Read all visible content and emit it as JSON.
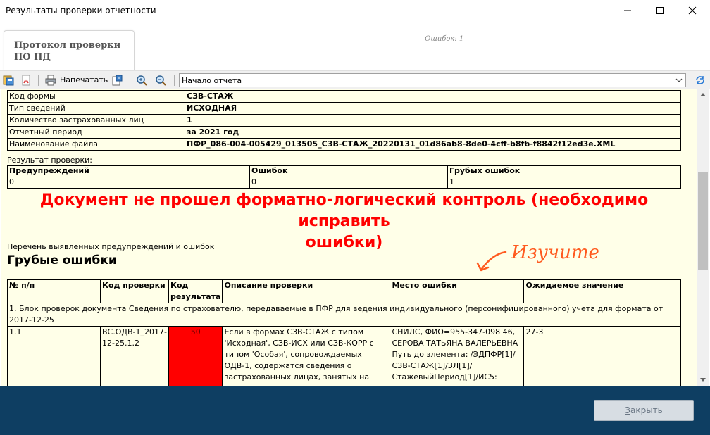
{
  "window": {
    "title": "Результаты проверки отчетности",
    "controls": {
      "minimize": "—",
      "maximize": "☐",
      "close": "✕"
    }
  },
  "tab": {
    "label_line1": "Протокол проверки",
    "label_line2": "ПО ПД"
  },
  "header_note": "— Ошибок: 1",
  "toolbar": {
    "print_label": "Напечатать",
    "nav_value": "Начало отчета"
  },
  "report": {
    "info_rows": [
      {
        "key": "Код формы",
        "value": "СЗВ-СТАЖ"
      },
      {
        "key": "Тип сведений",
        "value": "ИСХОДНАЯ"
      },
      {
        "key": "Количество застрахованных лиц",
        "value": "1"
      },
      {
        "key": "Отчетный период",
        "value": "за 2021 год"
      },
      {
        "key": "Наименование файла",
        "value": "ПФР_086-004-005429_013505_СЗВ-СТАЖ_20220131_01d86ab8-8de0-4cff-b8fb-f8842f12ed3e.XML"
      }
    ],
    "result_caption": "Результат проверки:",
    "result_headers": [
      "Предупреждений",
      "Ошибок",
      "Грубых ошибок"
    ],
    "result_values": [
      "0",
      "0",
      "1"
    ],
    "big_message_line1": "Документ не прошел форматно-логический контроль (необходимо исправить",
    "big_message_line2": "ошибки)",
    "list_caption": "Перечень выявленных предупреждений и ошибок",
    "section_title": "Грубые ошибки",
    "handnote": "Изучите",
    "error_headers": [
      "№ п/п",
      "Код проверки",
      "Код результата",
      "Описание проверки",
      "Место ошибки",
      "Ожидаемое значение"
    ],
    "block_row": "1. Блок проверок документа Сведения по страхователю, передаваемые в ПФР для ведения индивидуального (персонифицированного) учета для формата от 2017-12-25",
    "error_row": {
      "num": "1.1",
      "check_code": "ВС.ОДВ-1_2017-12-25.1.2",
      "result_code": "50",
      "description": "Если в формах СЗВ-СТАЖ с типом 'Исходная', СЗВ-ИСХ или СЗВ-КОРР с типом 'Особая', сопровождаемых ОДВ-1, содержатся сведения о застрахованных лицах, занятых на видах",
      "location": "СНИЛС, ФИО=955-347-098 46, СЕРОВА ТАТЬЯНА ВАЛЕРЬЕВНА Путь до элемента: /ЭДПФР[1]/ СЗВ-СТАЖ[1]/ЗЛ[1]/ СтажевыйПериод[1]/ИС5:",
      "expected": "27-3"
    }
  },
  "footer": {
    "close_label_underlined": "З",
    "close_label_rest": "акрыть"
  },
  "colors": {
    "accent_footer": "#0e3e62",
    "report_bg": "#ffffe8",
    "error_red": "#ff0000",
    "handnote_orange": "#ff5a1f"
  }
}
